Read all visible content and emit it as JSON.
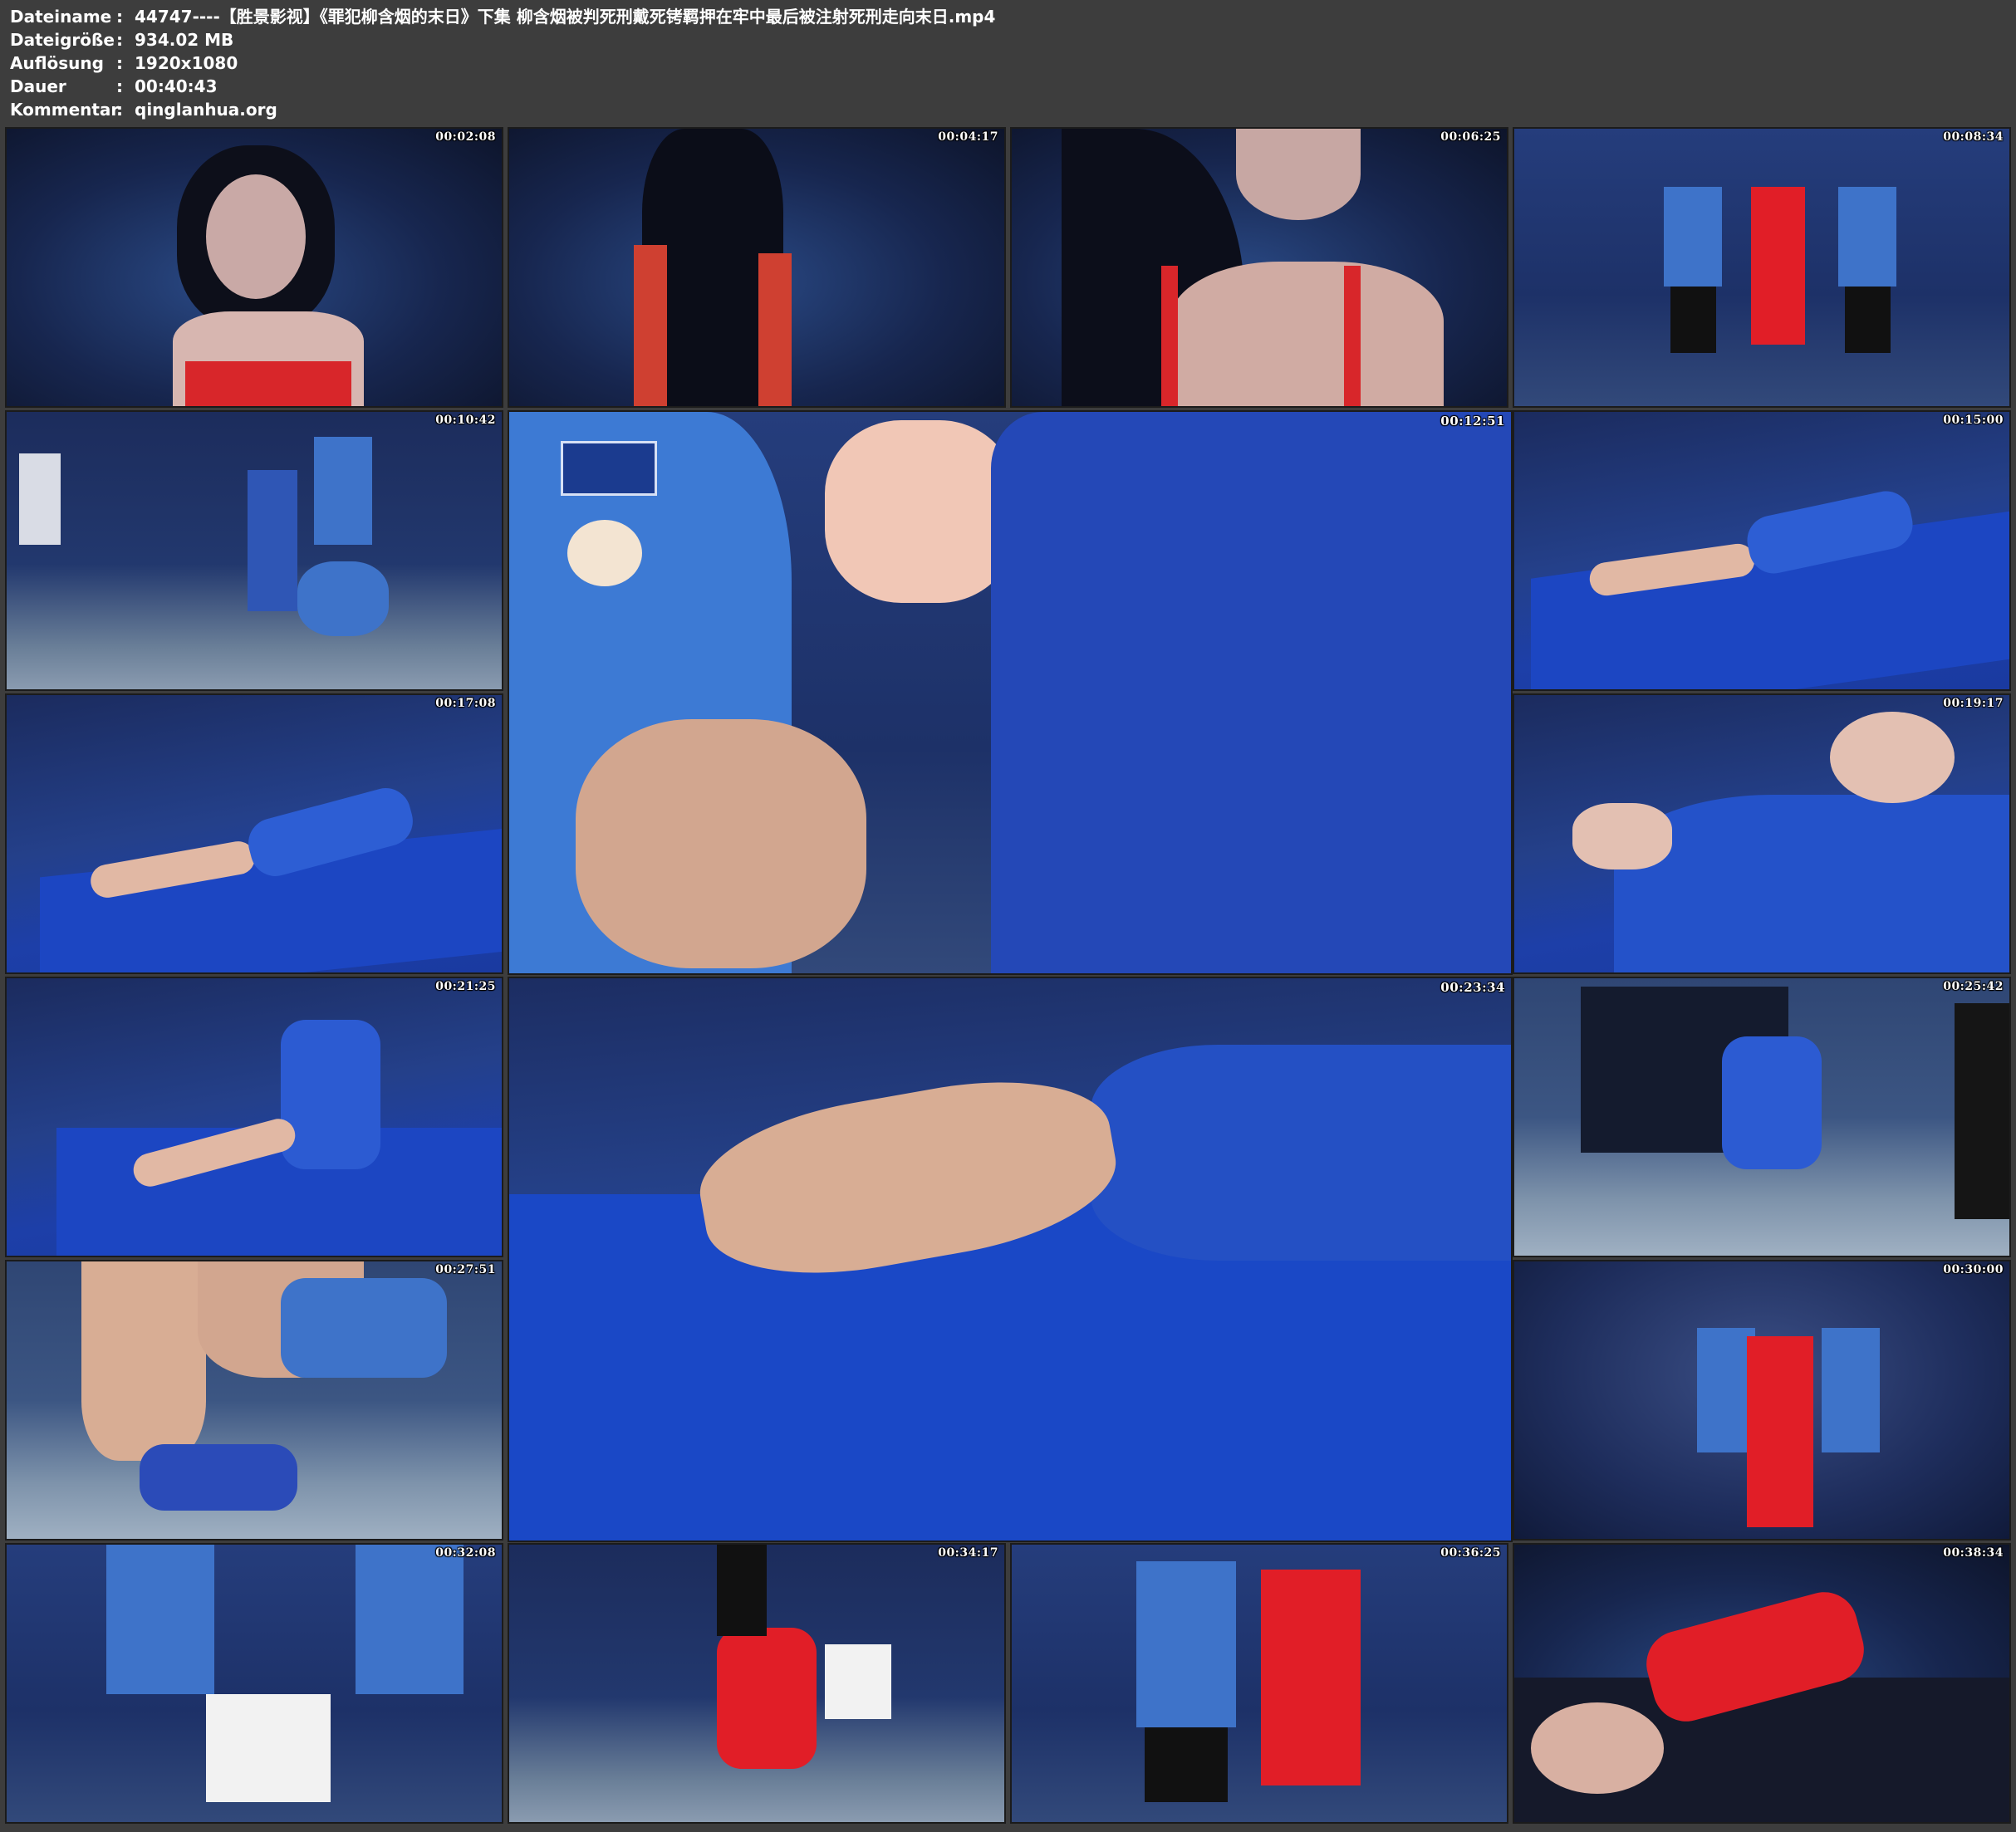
{
  "info": {
    "rows": [
      {
        "label": "Dateiname",
        "sep": ":",
        "value": "44747----【胜景影视】《罪犯柳含烟的末日》下集 柳含烟被判死刑戴死铐羁押在牢中最后被注射死刑走向末日.mp4"
      },
      {
        "label": "Dateigröße",
        "sep": ":",
        "value": "934.02 MB"
      },
      {
        "label": "Auflösung",
        "sep": ":",
        "value": "1920x1080"
      },
      {
        "label": "Dauer",
        "sep": ":",
        "value": "00:40:43"
      },
      {
        "label": "Kommentar",
        "sep": ":",
        "value": "qinglanhua.org"
      }
    ]
  },
  "thumbnails": [
    {
      "timestamp": "00:02:08",
      "scene": "woman-red-top-rope-portrait"
    },
    {
      "timestamp": "00:04:17",
      "scene": "woman-back-rope"
    },
    {
      "timestamp": "00:06:25",
      "scene": "woman-closeup-neck"
    },
    {
      "timestamp": "00:08:34",
      "scene": "three-women-standing"
    },
    {
      "timestamp": "00:10:42",
      "scene": "officer-fitting-shackles"
    },
    {
      "timestamp": "00:12:51",
      "scene": "handcuff-closeup"
    },
    {
      "timestamp": "00:15:00",
      "scene": "woman-lying-bed"
    },
    {
      "timestamp": "00:17:08",
      "scene": "woman-lying-bed-wide"
    },
    {
      "timestamp": "00:19:17",
      "scene": "woman-lying-closeup-9542"
    },
    {
      "timestamp": "00:21:25",
      "scene": "woman-sitting-bed"
    },
    {
      "timestamp": "00:23:34",
      "scene": "feet-shackles-closeup"
    },
    {
      "timestamp": "00:25:42",
      "scene": "woman-crouching"
    },
    {
      "timestamp": "00:27:51",
      "scene": "shackle-hammering"
    },
    {
      "timestamp": "00:30:00",
      "scene": "woman-red-dress-escorted"
    },
    {
      "timestamp": "00:32:08",
      "scene": "woman-with-sign"
    },
    {
      "timestamp": "00:34:17",
      "scene": "woman-kneeling"
    },
    {
      "timestamp": "00:36:25",
      "scene": "officer-cuffing"
    },
    {
      "timestamp": "00:38:34",
      "scene": "woman-lying-table"
    }
  ],
  "colors": {
    "background": "#3d3d3d",
    "text": "#ffffff",
    "prison_blue": "#1f44b0",
    "red_dress": "#e21d22"
  }
}
